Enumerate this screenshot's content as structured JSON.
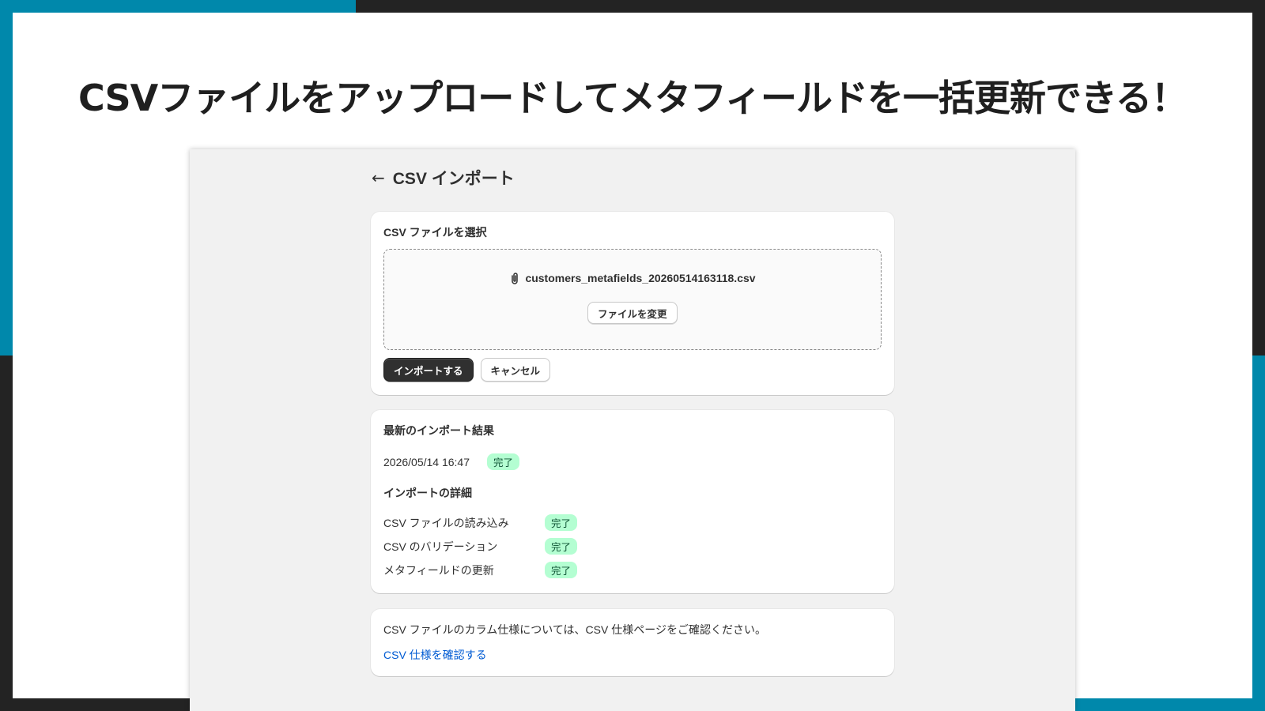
{
  "headline": "CSVファイルをアップロードしてメタフィールドを一括更新できる！",
  "colors": {
    "accent": "#0088ab",
    "frame": "#232323",
    "badge_bg": "#b4fed2",
    "link": "#005bd3"
  },
  "header": {
    "back_icon": "arrow-left-icon",
    "title": "CSV インポート"
  },
  "upload_card": {
    "title": "CSV ファイルを選択",
    "file_icon": "paperclip-icon",
    "file_name": "customers_metafields_20260514163118.csv",
    "change_file_label": "ファイルを変更",
    "import_label": "インポートする",
    "cancel_label": "キャンセル"
  },
  "result_card": {
    "title": "最新のインポート結果",
    "timestamp": "2026/05/14 16:47",
    "status": "完了",
    "details_title": "インポートの詳細",
    "steps": [
      {
        "label": "CSV ファイルの読み込み",
        "status": "完了"
      },
      {
        "label": "CSV のバリデーション",
        "status": "完了"
      },
      {
        "label": "メタフィールドの更新",
        "status": "完了"
      }
    ]
  },
  "spec_card": {
    "text": "CSV ファイルのカラム仕様については、CSV 仕様ページをご確認ください。",
    "link_label": "CSV 仕様を確認する"
  }
}
